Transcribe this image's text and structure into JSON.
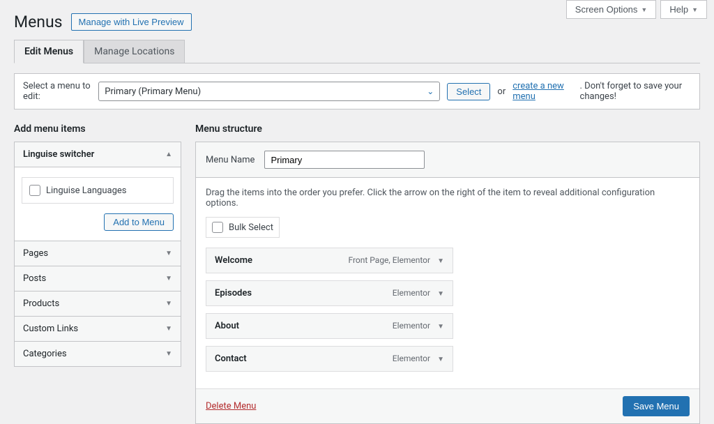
{
  "topbar": {
    "screen_options": "Screen Options",
    "help": "Help"
  },
  "header": {
    "title": "Menus",
    "preview_button": "Manage with Live Preview"
  },
  "tabs": {
    "edit": "Edit Menus",
    "locations": "Manage Locations"
  },
  "select_bar": {
    "label": "Select a menu to edit:",
    "selected": "Primary (Primary Menu)",
    "select_btn": "Select",
    "or": "or",
    "create_link": "create a new menu",
    "reminder": ". Don't forget to save your changes!"
  },
  "left": {
    "heading": "Add menu items",
    "sections": {
      "linguise": "Linguise switcher",
      "pages": "Pages",
      "posts": "Posts",
      "products": "Products",
      "custom_links": "Custom Links",
      "categories": "Categories"
    },
    "linguise_item": "Linguise Languages",
    "add_btn": "Add to Menu"
  },
  "right": {
    "heading": "Menu structure",
    "menu_name_label": "Menu Name",
    "menu_name_value": "Primary",
    "instructions": "Drag the items into the order you prefer. Click the arrow on the right of the item to reveal additional configuration options.",
    "bulk_select": "Bulk Select",
    "items": [
      {
        "title": "Welcome",
        "type": "Front Page, Elementor"
      },
      {
        "title": "Episodes",
        "type": "Elementor"
      },
      {
        "title": "About",
        "type": "Elementor"
      },
      {
        "title": "Contact",
        "type": "Elementor"
      }
    ],
    "delete": "Delete Menu",
    "save": "Save Menu"
  }
}
